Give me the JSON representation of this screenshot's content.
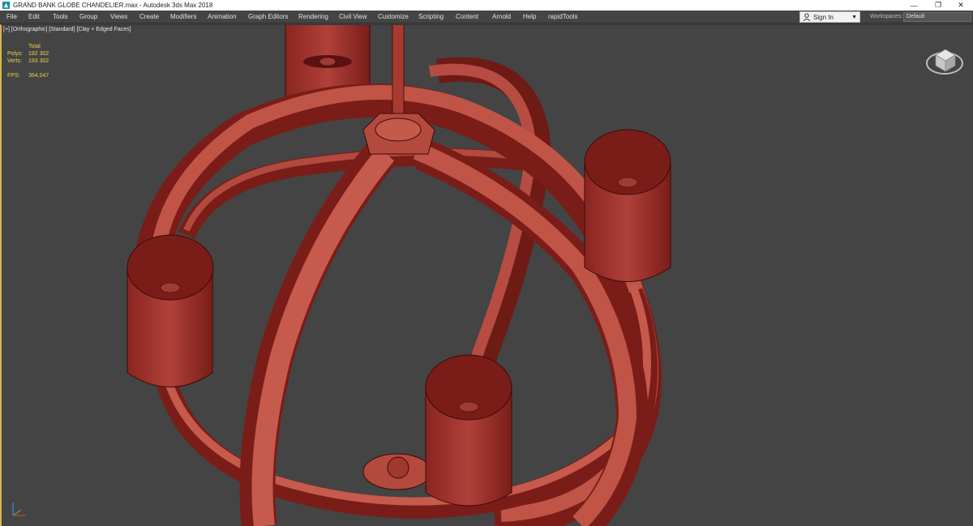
{
  "window": {
    "title": "GRAND BANK GLOBE CHANDELIER.max - Autodesk 3ds Max 2018",
    "controls": [
      "—",
      "❐",
      "✕"
    ]
  },
  "menu": [
    "File",
    "Edit",
    "Tools",
    "Group",
    "Views",
    "Create",
    "Modifiers",
    "Animation",
    "Graph Editors",
    "Rendering",
    "Civil View",
    "Customize",
    "Scripting",
    "Content",
    "Arnold",
    "Help",
    "rapidTools"
  ],
  "account": {
    "sign_in_label": "Sign In",
    "user_icon": "user-icon"
  },
  "workspace": {
    "label": "Workspaces:",
    "value": "Default"
  },
  "viewport": {
    "label": "[+] [Orthographic] [Standard] [Clay + Edged Faces]",
    "stats": {
      "total_label": "Total",
      "polys_label": "Polys:",
      "polys_value": "192 302",
      "verts_label": "Verts:",
      "verts_value": "193 302",
      "fps_label": "FPS:",
      "fps_value": "364,047"
    },
    "colors": {
      "clay": "#a83a30",
      "clay_light": "#c4574a",
      "clay_dark": "#6e1a15",
      "edge": "#3a0a08",
      "background": "#444444",
      "active_border": "#d8b84a"
    }
  }
}
